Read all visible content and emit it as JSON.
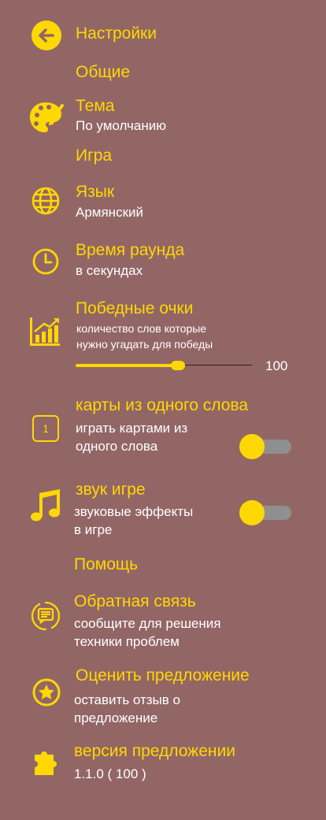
{
  "header": {
    "title": "Настройки"
  },
  "sections": {
    "general": "Общие",
    "game": "Игра",
    "help": "Помощь"
  },
  "theme": {
    "title": "Тема",
    "value": "По умолчанию"
  },
  "language": {
    "title": "Язык",
    "value": "Армянский"
  },
  "round_time": {
    "title": "Время раунда",
    "subtitle": "в секундах"
  },
  "win_points": {
    "title": "Победные очки",
    "subtitle_line1": "количество слов которые",
    "subtitle_line2": "нужно угадать для победы",
    "value": "100",
    "slider_fraction": 0.58
  },
  "single_word_cards": {
    "title": "карты из одного слова",
    "subtitle_line1": "играть картами из",
    "subtitle_line2": "одного слова",
    "icon_text": "1",
    "enabled": false
  },
  "sound": {
    "title": "звук игре",
    "subtitle_line1": "звуковые эффекты",
    "subtitle_line2": "в игре",
    "enabled": false
  },
  "feedback": {
    "title": "Обратная связь",
    "subtitle_line1": "сообщите для решения",
    "subtitle_line2": "техники проблем"
  },
  "rate": {
    "title": "Оценить предложение",
    "subtitle_line1": "оставить отзыв о",
    "subtitle_line2": "предложение"
  },
  "version": {
    "title": "версия предложении",
    "value": "1.1.0 ( 100 )"
  },
  "colors": {
    "background": "#936666",
    "accent": "#ffd800",
    "toggle_track": "#8f8f8f",
    "text": "#ffffff"
  },
  "icons": {
    "back": "arrow-left-circle-icon",
    "theme": "palette-icon",
    "language": "globe-icon",
    "round_time": "clock-icon",
    "win_points": "bar-chart-icon",
    "single_word": "number-one-box-icon",
    "sound": "music-note-icon",
    "feedback": "chat-refresh-icon",
    "rate": "star-circle-icon",
    "version": "puzzle-icon"
  }
}
